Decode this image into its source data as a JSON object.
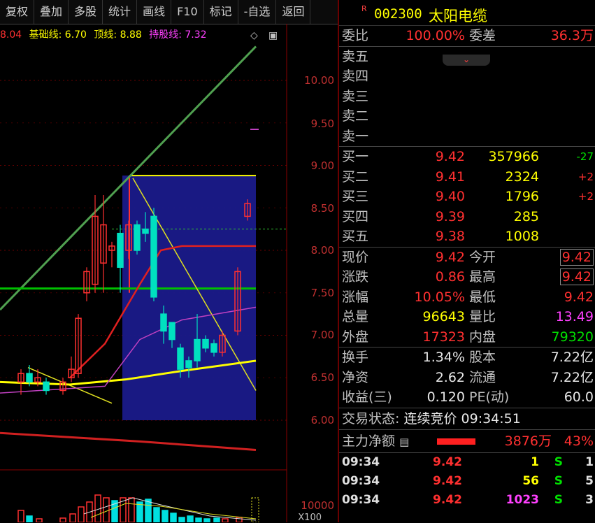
{
  "toolbar": [
    "复权",
    "叠加",
    "多股",
    "统计",
    "画线",
    "F10",
    "标记",
    "-自选",
    "返回"
  ],
  "legend": {
    "partial": "8.04",
    "base": "基础线: 6.70",
    "top": "顶线: 8.88",
    "hold": "持股线: 7.32"
  },
  "colors": {
    "up": "#ff3030",
    "down": "#00e0e0",
    "price_axis": "#c03030",
    "quote_yellow": "#ffff00",
    "green": "#00e000",
    "magenta": "#ff40ff"
  },
  "price_axis": [
    "10.00",
    "9.50",
    "9.00",
    "8.50",
    "8.00",
    "7.50",
    "7.00",
    "6.50",
    "6.00"
  ],
  "volume_axis": {
    "value": "10000",
    "unit": "X100"
  },
  "chart_data": {
    "type": "candlestick",
    "ylim": [
      6.0,
      10.0
    ],
    "lines": {
      "base": 6.7,
      "top": 8.88,
      "hold": 7.32
    }
  },
  "stock": {
    "r_mark": "R",
    "code": "002300",
    "name": "太阳电缆"
  },
  "weibi": {
    "label": "委比",
    "value": "100.00%",
    "label2": "委差",
    "value2": "36.3万"
  },
  "sells": [
    {
      "label": "卖五"
    },
    {
      "label": "卖四"
    },
    {
      "label": "卖三"
    },
    {
      "label": "卖二"
    },
    {
      "label": "卖一"
    }
  ],
  "buys": [
    {
      "label": "买一",
      "price": "9.42",
      "vol": "357966",
      "chg": "-27"
    },
    {
      "label": "买二",
      "price": "9.41",
      "vol": "2324",
      "chg": "+2"
    },
    {
      "label": "买三",
      "price": "9.40",
      "vol": "1796",
      "chg": "+2"
    },
    {
      "label": "买四",
      "price": "9.39",
      "vol": "285",
      "chg": ""
    },
    {
      "label": "买五",
      "price": "9.38",
      "vol": "1008",
      "chg": ""
    }
  ],
  "stats": [
    {
      "l1": "现价",
      "v1": "9.42",
      "c1": "red",
      "l2": "今开",
      "v2": "9.42",
      "c2": "red",
      "box": true
    },
    {
      "l1": "涨跌",
      "v1": "0.86",
      "c1": "red",
      "l2": "最高",
      "v2": "9.42",
      "c2": "red",
      "box": true
    },
    {
      "l1": "涨幅",
      "v1": "10.05%",
      "c1": "red",
      "l2": "最低",
      "v2": "9.42",
      "c2": "red",
      "box": false
    },
    {
      "l1": "总量",
      "v1": "96643",
      "c1": "yellow",
      "l2": "量比",
      "v2": "13.49",
      "c2": "magenta",
      "box": false
    },
    {
      "l1": "外盘",
      "v1": "17323",
      "c1": "red",
      "l2": "内盘",
      "v2": "79320",
      "c2": "green",
      "box": false
    }
  ],
  "fin": [
    {
      "l1": "换手",
      "v1": "1.34%",
      "l2": "股本",
      "v2": "7.22亿"
    },
    {
      "l1": "净资",
      "v1": "2.62",
      "l2": "流通",
      "v2": "7.22亿"
    },
    {
      "l1": "收益(三)",
      "v1": "0.120",
      "l2": "PE(动)",
      "v2": "60.0"
    }
  ],
  "status": {
    "label": "交易状态:",
    "value": "连续竞价",
    "time": "09:34:51"
  },
  "flow": {
    "label": "主力净额",
    "amount": "3876万",
    "pct": "43%"
  },
  "ticks": [
    {
      "time": "09:34",
      "price": "9.42",
      "vol": "1",
      "vcolor": "yellow",
      "side": "S",
      "n": "1"
    },
    {
      "time": "09:34",
      "price": "9.42",
      "vol": "56",
      "vcolor": "yellow",
      "side": "S",
      "n": "5"
    },
    {
      "time": "09:34",
      "price": "9.42",
      "vol": "1023",
      "vcolor": "magenta",
      "side": "S",
      "n": "3"
    }
  ]
}
